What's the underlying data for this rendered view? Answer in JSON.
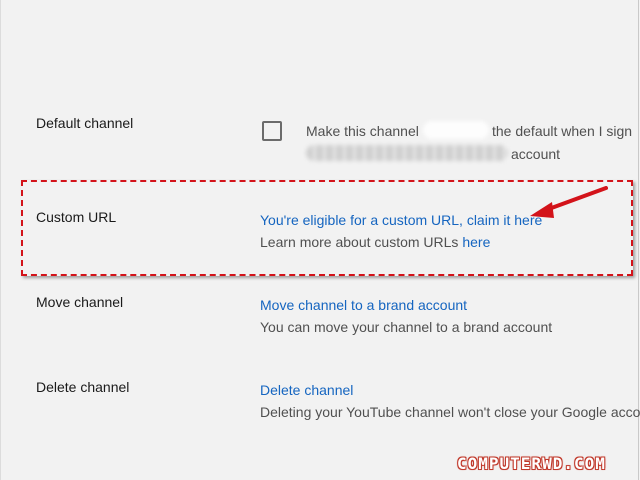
{
  "settings": {
    "default_channel": {
      "label": "Default channel",
      "checkbox_text_before": "Make this channel",
      "checkbox_text_after": "the default when I sign",
      "account_suffix": "account",
      "checked": false
    },
    "custom_url": {
      "label": "Custom URL",
      "link": "You're eligible for a custom URL, claim it here",
      "learn_more_prefix": "Learn more about custom URLs ",
      "learn_more_link": "here"
    },
    "move_channel": {
      "label": "Move channel",
      "link": "Move channel to a brand account",
      "description": "You can move your channel to a brand account"
    },
    "delete_channel": {
      "label": "Delete channel",
      "link": "Delete channel",
      "description": "Deleting your YouTube channel won't close your Google acco"
    }
  },
  "annotation": {
    "highlight_color": "#d3131a",
    "arrow_icon": "red-arrow-icon"
  },
  "watermark": "COMPUTERWD.COM"
}
